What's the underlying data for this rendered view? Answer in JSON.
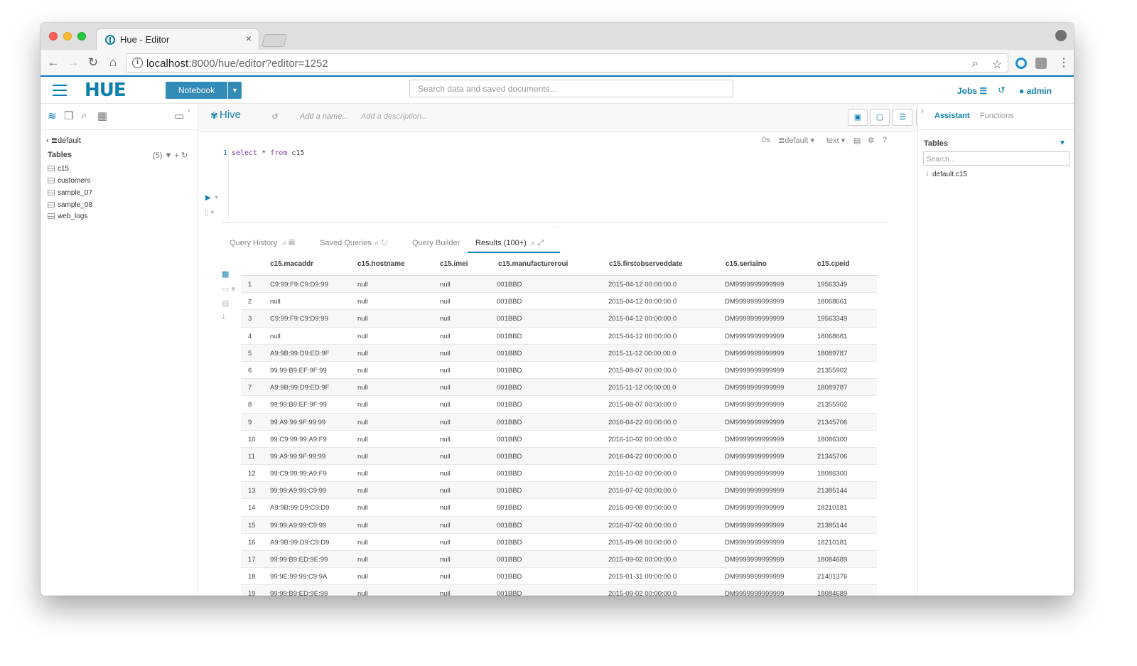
{
  "browser": {
    "tab_title": "Hue - Editor",
    "tab_close": "×",
    "url_host": "localhost",
    "url_path": ":8000/hue/editor?editor=1252"
  },
  "hue": {
    "logo": "HUE",
    "notebook_label": "Notebook",
    "search_placeholder": "Search data and saved documents...",
    "jobs_label": "Jobs",
    "user_label": "admin"
  },
  "left_panel": {
    "database": "default",
    "tables_label": "Tables",
    "tables_count": "(5)",
    "tables": [
      "c15",
      "customers",
      "sample_07",
      "sample_08",
      "web_logs"
    ]
  },
  "editor": {
    "type_label": "Hive",
    "name_placeholder": "Add a name...",
    "description_placeholder": "Add a description...",
    "exec_time": "0s",
    "database": "default",
    "format": "text",
    "line_number": "1",
    "query_keyword_select": "select",
    "query_middle": " * ",
    "query_keyword_from": "from",
    "query_table": " c15"
  },
  "result_tabs": {
    "query_history": "Query History",
    "saved_queries": "Saved Queries",
    "query_builder": "Query Builder",
    "results": "Results (100+)"
  },
  "grid": {
    "columns": [
      "c15.macaddr",
      "c15.hostname",
      "c15.imei",
      "c15.manufactureroui",
      "c15.firstobserveddate",
      "c15.serialno",
      "c15.cpeid"
    ],
    "rows": [
      [
        "1",
        "C9:99:F9:C9:D9:99",
        "null",
        "null",
        "001BBD",
        "2015-04-12 00:00:00.0",
        "DM9999999999999",
        "19563349"
      ],
      [
        "2",
        "null",
        "null",
        "null",
        "001BBD",
        "2015-04-12 00:00:00.0",
        "DM9999999999999",
        "18068661"
      ],
      [
        "3",
        "C9:99:F9:C9:D9:99",
        "null",
        "null",
        "001BBD",
        "2015-04-12 00:00:00.0",
        "DM9999999999999",
        "19563349"
      ],
      [
        "4",
        "null",
        "null",
        "null",
        "001BBD",
        "2015-04-12 00:00:00.0",
        "DM9999999999999",
        "18068661"
      ],
      [
        "5",
        "A9:9B:99:D9:ED:9F",
        "null",
        "null",
        "001BBD",
        "2015-11-12 00:00:00.0",
        "DM9999999999999",
        "18089787"
      ],
      [
        "6",
        "99:99:B9:EF:9F:99",
        "null",
        "null",
        "001BBD",
        "2015-08-07 00:00:00.0",
        "DM9999999999999",
        "21355902"
      ],
      [
        "7",
        "A9:9B:99:D9:ED:9F",
        "null",
        "null",
        "001BBD",
        "2015-11-12 00:00:00.0",
        "DM9999999999999",
        "18089787"
      ],
      [
        "8",
        "99:99:B9:EF:9F:99",
        "null",
        "null",
        "001BBD",
        "2015-08-07 00:00:00.0",
        "DM9999999999999",
        "21355902"
      ],
      [
        "9",
        "99:A9:99:9F:99:99",
        "null",
        "null",
        "001BBD",
        "2016-04-22 00:00:00.0",
        "DM9999999999999",
        "21345706"
      ],
      [
        "10",
        "99:C9:99:99:A9:F9",
        "null",
        "null",
        "001BBD",
        "2016-10-02 00:00:00.0",
        "DM9999999999999",
        "18086300"
      ],
      [
        "11",
        "99:A9:99:9F:99:99",
        "null",
        "null",
        "001BBD",
        "2016-04-22 00:00:00.0",
        "DM9999999999999",
        "21345706"
      ],
      [
        "12",
        "99:C9:99:99:A9:F9",
        "null",
        "null",
        "001BBD",
        "2016-10-02 00:00:00.0",
        "DM9999999999999",
        "18086300"
      ],
      [
        "13",
        "99:99:A9:99:C9:99",
        "null",
        "null",
        "001BBD",
        "2016-07-02 00:00:00.0",
        "DM9999999999999",
        "21385144"
      ],
      [
        "14",
        "A9:9B:99:D9:C9:D9",
        "null",
        "null",
        "001BBD",
        "2015-09-08 00:00:00.0",
        "DM9999999999999",
        "18210181"
      ],
      [
        "15",
        "99:99:A9:99:C9:99",
        "null",
        "null",
        "001BBD",
        "2016-07-02 00:00:00.0",
        "DM9999999999999",
        "21385144"
      ],
      [
        "16",
        "A9:9B:99:D9:C9:D9",
        "null",
        "null",
        "001BBD",
        "2015-09-08 00:00:00.0",
        "DM9999999999999",
        "18210181"
      ],
      [
        "17",
        "99:99:B9:ED:9E:99",
        "null",
        "null",
        "001BBD",
        "2015-09-02 00:00:00.0",
        "DM9999999999999",
        "18084689"
      ],
      [
        "18",
        "99:9E:99:99:C9:9A",
        "null",
        "null",
        "001BBD",
        "2015-01-31 00:00:00.0",
        "DM9999999999999",
        "21401376"
      ],
      [
        "19",
        "99:99:B9:ED:9E:99",
        "null",
        "null",
        "001BBD",
        "2015-09-02 00:00:00.0",
        "DM9999999999999",
        "18084689"
      ]
    ]
  },
  "right_panel": {
    "tab_assistant": "Assistant",
    "tab_functions": "Functions",
    "tables_label": "Tables",
    "search_placeholder": "Search...",
    "item": "default.c15"
  },
  "icons": {
    "accent_color": "#0b7fad",
    "button_color": "#338bb8"
  }
}
